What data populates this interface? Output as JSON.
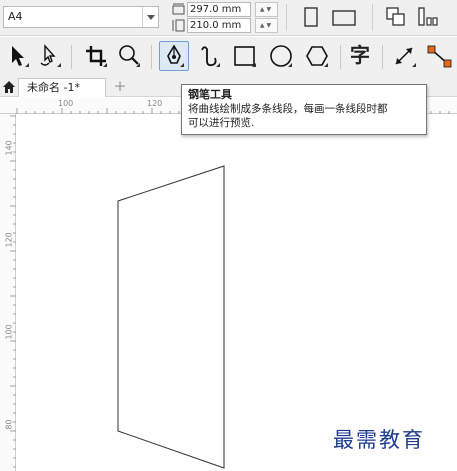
{
  "property_bar": {
    "paper_size": "A4",
    "width_value": "297.0 mm",
    "height_value": "210.0 mm",
    "spinner_up": "▲",
    "spinner_down": "▼",
    "buttons": [
      "portrait-icon",
      "landscape-icon",
      "all-pages-icon",
      "current-page-icon"
    ]
  },
  "toolbox": {
    "tools": [
      "pick-tool",
      "freehand-pick-tool",
      "crop-tool",
      "zoom-tool",
      "pen-tool",
      "freehand-tool",
      "rectangle-tool",
      "ellipse-tool",
      "polygon-tool",
      "text-tool",
      "parallel-dimension-tool",
      "connector-tool"
    ],
    "active_tool": "pen-tool",
    "text_tool_label": "字"
  },
  "document_tabs": {
    "active_tab_label": "未命名 -1*",
    "add_tab_label": "+"
  },
  "rulers": {
    "horizontal_labels": [
      "100",
      "120"
    ],
    "vertical_labels": [
      "140",
      "120",
      "100",
      "80"
    ]
  },
  "tooltip": {
    "title": "钢笔工具",
    "description_line1": "将曲线绘制成多条线段，每画一条线段时都",
    "description_line2": "可以进行预览."
  },
  "watermark": {
    "text": "最需教育"
  },
  "colors": {
    "active_tool_bg": "#dde9f5",
    "active_tool_border": "#6f9fd2",
    "watermark": "#1f3c8f",
    "connector_accent": "#e06a1a"
  }
}
